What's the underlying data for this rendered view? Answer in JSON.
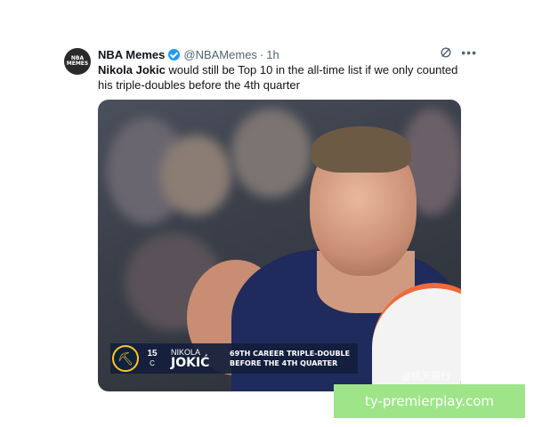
{
  "tweet": {
    "avatar_text": "NBA MEMES",
    "author_name": "NBA Memes",
    "handle": "@NBAMemes",
    "dot": "·",
    "time": "1h",
    "more": "•••",
    "text_bold": "Nikola Jokic",
    "text_rest": " would still be Top 10 in the all-time list if we only counted his triple-doubles before the 4th quarter"
  },
  "media": {
    "jersey_number": "15",
    "position": "C",
    "first_name": "NIKOLA",
    "last_name": "JOKIĆ",
    "stat_line1": "69TH CAREER TRIPLE-DOUBLE",
    "stat_line2": "BEFORE THE 4TH QUARTER",
    "watermark": "@桃天摄行"
  },
  "promo": {
    "text": "ty-premierplay.com"
  },
  "colors": {
    "verified": "#1d9bf0",
    "nuggets_gold": "#fec524",
    "nuggets_navy": "#0e2240",
    "promo_bg": "#9ee58a"
  }
}
